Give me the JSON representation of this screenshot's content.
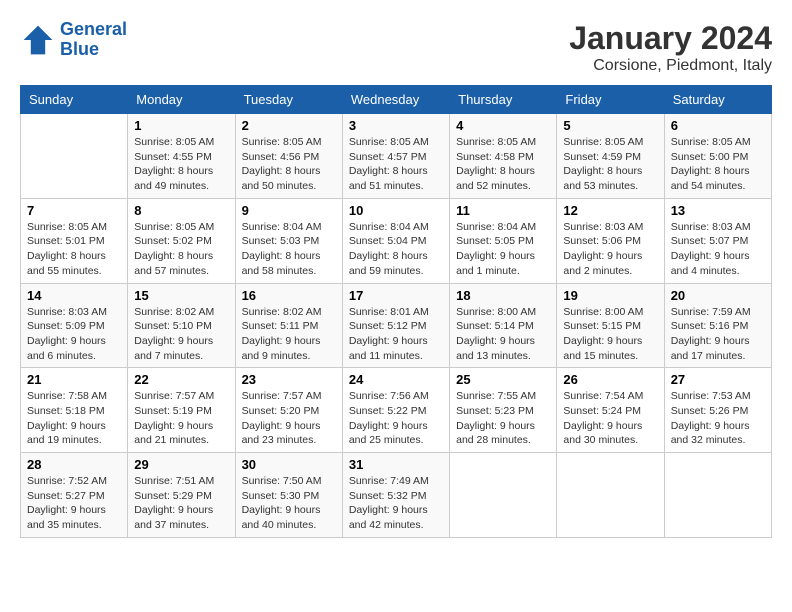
{
  "logo": {
    "line1": "General",
    "line2": "Blue"
  },
  "title": "January 2024",
  "subtitle": "Corsione, Piedmont, Italy",
  "days_of_week": [
    "Sunday",
    "Monday",
    "Tuesday",
    "Wednesday",
    "Thursday",
    "Friday",
    "Saturday"
  ],
  "weeks": [
    [
      {
        "day": "",
        "sunrise": "",
        "sunset": "",
        "daylight": ""
      },
      {
        "day": "1",
        "sunrise": "Sunrise: 8:05 AM",
        "sunset": "Sunset: 4:55 PM",
        "daylight": "Daylight: 8 hours and 49 minutes."
      },
      {
        "day": "2",
        "sunrise": "Sunrise: 8:05 AM",
        "sunset": "Sunset: 4:56 PM",
        "daylight": "Daylight: 8 hours and 50 minutes."
      },
      {
        "day": "3",
        "sunrise": "Sunrise: 8:05 AM",
        "sunset": "Sunset: 4:57 PM",
        "daylight": "Daylight: 8 hours and 51 minutes."
      },
      {
        "day": "4",
        "sunrise": "Sunrise: 8:05 AM",
        "sunset": "Sunset: 4:58 PM",
        "daylight": "Daylight: 8 hours and 52 minutes."
      },
      {
        "day": "5",
        "sunrise": "Sunrise: 8:05 AM",
        "sunset": "Sunset: 4:59 PM",
        "daylight": "Daylight: 8 hours and 53 minutes."
      },
      {
        "day": "6",
        "sunrise": "Sunrise: 8:05 AM",
        "sunset": "Sunset: 5:00 PM",
        "daylight": "Daylight: 8 hours and 54 minutes."
      }
    ],
    [
      {
        "day": "7",
        "sunrise": "Sunrise: 8:05 AM",
        "sunset": "Sunset: 5:01 PM",
        "daylight": "Daylight: 8 hours and 55 minutes."
      },
      {
        "day": "8",
        "sunrise": "Sunrise: 8:05 AM",
        "sunset": "Sunset: 5:02 PM",
        "daylight": "Daylight: 8 hours and 57 minutes."
      },
      {
        "day": "9",
        "sunrise": "Sunrise: 8:04 AM",
        "sunset": "Sunset: 5:03 PM",
        "daylight": "Daylight: 8 hours and 58 minutes."
      },
      {
        "day": "10",
        "sunrise": "Sunrise: 8:04 AM",
        "sunset": "Sunset: 5:04 PM",
        "daylight": "Daylight: 8 hours and 59 minutes."
      },
      {
        "day": "11",
        "sunrise": "Sunrise: 8:04 AM",
        "sunset": "Sunset: 5:05 PM",
        "daylight": "Daylight: 9 hours and 1 minute."
      },
      {
        "day": "12",
        "sunrise": "Sunrise: 8:03 AM",
        "sunset": "Sunset: 5:06 PM",
        "daylight": "Daylight: 9 hours and 2 minutes."
      },
      {
        "day": "13",
        "sunrise": "Sunrise: 8:03 AM",
        "sunset": "Sunset: 5:07 PM",
        "daylight": "Daylight: 9 hours and 4 minutes."
      }
    ],
    [
      {
        "day": "14",
        "sunrise": "Sunrise: 8:03 AM",
        "sunset": "Sunset: 5:09 PM",
        "daylight": "Daylight: 9 hours and 6 minutes."
      },
      {
        "day": "15",
        "sunrise": "Sunrise: 8:02 AM",
        "sunset": "Sunset: 5:10 PM",
        "daylight": "Daylight: 9 hours and 7 minutes."
      },
      {
        "day": "16",
        "sunrise": "Sunrise: 8:02 AM",
        "sunset": "Sunset: 5:11 PM",
        "daylight": "Daylight: 9 hours and 9 minutes."
      },
      {
        "day": "17",
        "sunrise": "Sunrise: 8:01 AM",
        "sunset": "Sunset: 5:12 PM",
        "daylight": "Daylight: 9 hours and 11 minutes."
      },
      {
        "day": "18",
        "sunrise": "Sunrise: 8:00 AM",
        "sunset": "Sunset: 5:14 PM",
        "daylight": "Daylight: 9 hours and 13 minutes."
      },
      {
        "day": "19",
        "sunrise": "Sunrise: 8:00 AM",
        "sunset": "Sunset: 5:15 PM",
        "daylight": "Daylight: 9 hours and 15 minutes."
      },
      {
        "day": "20",
        "sunrise": "Sunrise: 7:59 AM",
        "sunset": "Sunset: 5:16 PM",
        "daylight": "Daylight: 9 hours and 17 minutes."
      }
    ],
    [
      {
        "day": "21",
        "sunrise": "Sunrise: 7:58 AM",
        "sunset": "Sunset: 5:18 PM",
        "daylight": "Daylight: 9 hours and 19 minutes."
      },
      {
        "day": "22",
        "sunrise": "Sunrise: 7:57 AM",
        "sunset": "Sunset: 5:19 PM",
        "daylight": "Daylight: 9 hours and 21 minutes."
      },
      {
        "day": "23",
        "sunrise": "Sunrise: 7:57 AM",
        "sunset": "Sunset: 5:20 PM",
        "daylight": "Daylight: 9 hours and 23 minutes."
      },
      {
        "day": "24",
        "sunrise": "Sunrise: 7:56 AM",
        "sunset": "Sunset: 5:22 PM",
        "daylight": "Daylight: 9 hours and 25 minutes."
      },
      {
        "day": "25",
        "sunrise": "Sunrise: 7:55 AM",
        "sunset": "Sunset: 5:23 PM",
        "daylight": "Daylight: 9 hours and 28 minutes."
      },
      {
        "day": "26",
        "sunrise": "Sunrise: 7:54 AM",
        "sunset": "Sunset: 5:24 PM",
        "daylight": "Daylight: 9 hours and 30 minutes."
      },
      {
        "day": "27",
        "sunrise": "Sunrise: 7:53 AM",
        "sunset": "Sunset: 5:26 PM",
        "daylight": "Daylight: 9 hours and 32 minutes."
      }
    ],
    [
      {
        "day": "28",
        "sunrise": "Sunrise: 7:52 AM",
        "sunset": "Sunset: 5:27 PM",
        "daylight": "Daylight: 9 hours and 35 minutes."
      },
      {
        "day": "29",
        "sunrise": "Sunrise: 7:51 AM",
        "sunset": "Sunset: 5:29 PM",
        "daylight": "Daylight: 9 hours and 37 minutes."
      },
      {
        "day": "30",
        "sunrise": "Sunrise: 7:50 AM",
        "sunset": "Sunset: 5:30 PM",
        "daylight": "Daylight: 9 hours and 40 minutes."
      },
      {
        "day": "31",
        "sunrise": "Sunrise: 7:49 AM",
        "sunset": "Sunset: 5:32 PM",
        "daylight": "Daylight: 9 hours and 42 minutes."
      },
      {
        "day": "",
        "sunrise": "",
        "sunset": "",
        "daylight": ""
      },
      {
        "day": "",
        "sunrise": "",
        "sunset": "",
        "daylight": ""
      },
      {
        "day": "",
        "sunrise": "",
        "sunset": "",
        "daylight": ""
      }
    ]
  ]
}
